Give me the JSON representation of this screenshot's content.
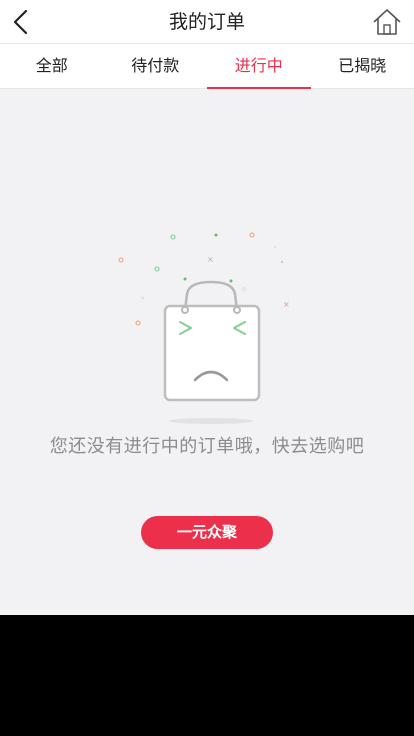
{
  "header": {
    "title": "我的订单",
    "back_icon": "chevron-left-icon",
    "home_icon": "home-icon"
  },
  "tabs": [
    {
      "label": "全部",
      "active": false
    },
    {
      "label": "待付款",
      "active": false
    },
    {
      "label": "进行中",
      "active": true
    },
    {
      "label": "已揭晓",
      "active": false
    }
  ],
  "empty_state": {
    "illustration_icon": "sad-shopping-bag-icon",
    "message": "您还没有进行中的订单哦，快去选购吧",
    "button_label": "一元众聚"
  },
  "colors": {
    "accent": "#e8304a",
    "button": "#ec2f4b",
    "background": "#f2f1f3",
    "header_bg": "#ffffff",
    "message_text": "#8c8c8c"
  }
}
